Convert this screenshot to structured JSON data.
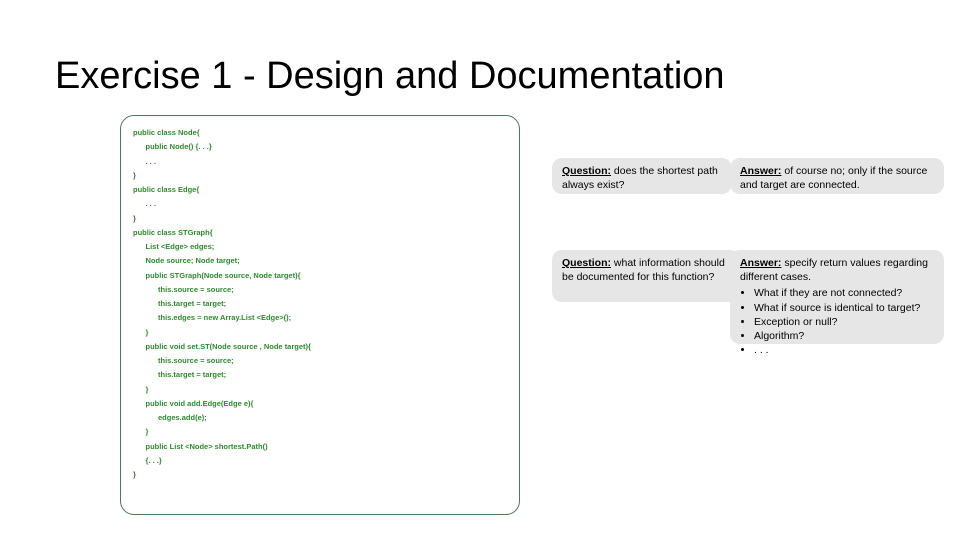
{
  "title": "Exercise 1 - Design and Documentation",
  "code": {
    "l01": "public class Node{",
    "l02": "      public Node() {. . .}",
    "l03": "      . . .",
    "l04": "}",
    "l05": "public class Edge{",
    "l06": "      . . .",
    "l07": "}",
    "l08": "public class STGraph{",
    "l09": "      List <Edge> edges;",
    "l10": "      Node source; Node target;",
    "l11": "      public STGraph(Node source, Node target){",
    "l12": "            this.source = source;",
    "l13": "            this.target = target;",
    "l14": "            this.edges = new Array.List <Edge>();",
    "l15": "      }",
    "l16": "      public void set.ST(Node source , Node target){",
    "l17": "            this.source = source;",
    "l18": "            this.target = target;",
    "l19": "      }",
    "l20": "      public void add.Edge(Edge e){",
    "l21": "            edges.add(e);",
    "l22": "      }",
    "l23": "      public List <Node> shortest.Path()",
    "l24": "      {. . .}",
    "l25": "}"
  },
  "q1": {
    "label": "Question:",
    "text": " does the shortest path always exist?"
  },
  "a1": {
    "label": "Answer:",
    "text": " of course no; only if the source and target are connected."
  },
  "q2": {
    "label": "Question:",
    "text": " what information should be documented for this function?"
  },
  "a2": {
    "label": "Answer:",
    "lead": " specify return values regarding different cases.",
    "b1": "What if they are not connected?",
    "b2": "What if source is identical to target?",
    "b3": "Exception or null?",
    "b4": "Algorithm?",
    "b5": ". . ."
  }
}
